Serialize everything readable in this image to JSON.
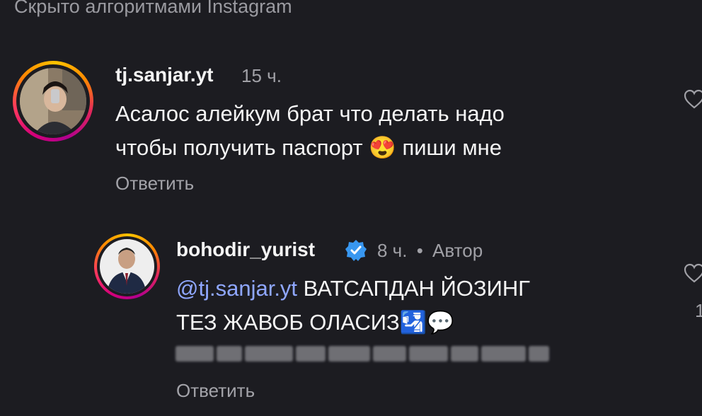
{
  "header": {
    "hidden_label": "Скрыто алгоритмами Instagram"
  },
  "comments": [
    {
      "username": "tj.sanjar.yt",
      "time": "15 ч.",
      "lines": [
        "Асалос алейкум брат что делать надо",
        "чтобы получить паспорт",
        "пиши мне"
      ],
      "emoji": "😍",
      "reply_label": "Ответить"
    },
    {
      "username": "bohodir_yurist",
      "verified": true,
      "time": "8 ч.",
      "separator": "•",
      "author_label": "Автор",
      "mention_icon": "@",
      "mention": "tj.sanjar.yt",
      "line1_rest": "ВАТСАПДАН ЙОЗИНГ",
      "line2": "ТЕЗ ЖАВОБ ОЛАСИЗ",
      "emoji_passport": "🛂",
      "emoji_speech": "💬",
      "reply_label": "Ответить"
    }
  ],
  "colors": {
    "background": "#1c1c21",
    "mention": "#8fa7ff",
    "verified": "#3897f0"
  },
  "icons": [
    "heart-icon",
    "verified-badge-icon"
  ],
  "edge_fragment": "1"
}
